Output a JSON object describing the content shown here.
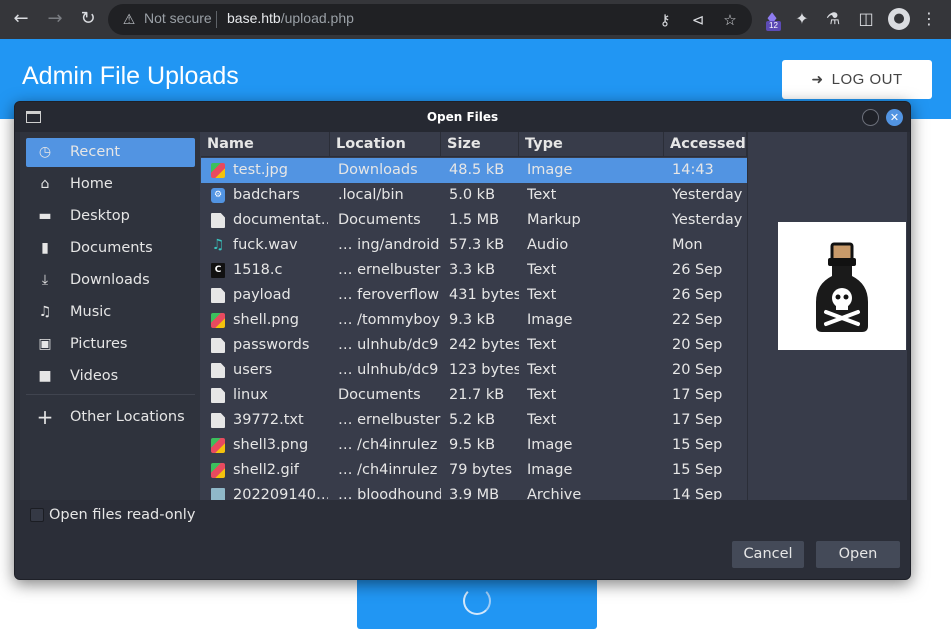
{
  "browser": {
    "security_label": "Not secure",
    "url_host": "base.htb",
    "url_path": "/upload.php",
    "extension_badge": "12"
  },
  "page": {
    "title": "Admin File Uploads",
    "logout_label": "LOG OUT"
  },
  "dialog": {
    "title": "Open Files",
    "sidebar": [
      {
        "label": "Recent",
        "icon": "clock-icon",
        "active": true
      },
      {
        "label": "Home",
        "icon": "home-icon"
      },
      {
        "label": "Desktop",
        "icon": "desktop-icon"
      },
      {
        "label": "Documents",
        "icon": "document-icon"
      },
      {
        "label": "Downloads",
        "icon": "download-icon"
      },
      {
        "label": "Music",
        "icon": "music-icon"
      },
      {
        "label": "Pictures",
        "icon": "picture-icon"
      },
      {
        "label": "Videos",
        "icon": "video-icon"
      },
      {
        "label": "Other Locations",
        "icon": "plus-icon"
      }
    ],
    "columns": [
      "Name",
      "Location",
      "Size",
      "Type",
      "Accessed"
    ],
    "files": [
      {
        "name": "test.jpg",
        "location": "Downloads",
        "size": "48.5 kB",
        "type": "Image",
        "accessed": "14:43",
        "icon": "image-icon",
        "selected": true
      },
      {
        "name": "badchars",
        "location": ".local/bin",
        "size": "5.0 kB",
        "type": "Text",
        "accessed": "Yesterday",
        "icon": "executable-icon"
      },
      {
        "name": "documentat…",
        "location": "Documents",
        "size": "1.5 MB",
        "type": "Markup",
        "accessed": "Yesterday",
        "icon": "text-file-icon"
      },
      {
        "name": "fuck.wav",
        "location": "… ing/android",
        "size": "57.3 kB",
        "type": "Audio",
        "accessed": "Mon",
        "icon": "audio-icon"
      },
      {
        "name": "1518.c",
        "location": "… ernelbuster",
        "size": "3.3 kB",
        "type": "Text",
        "accessed": "26 Sep",
        "icon": "c-source-icon"
      },
      {
        "name": "payload",
        "location": "… feroverflow",
        "size": "431 bytes",
        "type": "Text",
        "accessed": "26 Sep",
        "icon": "text-file-icon"
      },
      {
        "name": "shell.png",
        "location": "… /tommyboy",
        "size": "9.3 kB",
        "type": "Image",
        "accessed": "22 Sep",
        "icon": "image-icon"
      },
      {
        "name": "passwords",
        "location": "… ulnhub/dc9",
        "size": "242 bytes",
        "type": "Text",
        "accessed": "20 Sep",
        "icon": "text-file-icon"
      },
      {
        "name": "users",
        "location": "… ulnhub/dc9",
        "size": "123 bytes",
        "type": "Text",
        "accessed": "20 Sep",
        "icon": "text-file-icon"
      },
      {
        "name": "linux",
        "location": "Documents",
        "size": "21.7 kB",
        "type": "Text",
        "accessed": "17 Sep",
        "icon": "text-file-icon"
      },
      {
        "name": "39772.txt",
        "location": "… ernelbuster",
        "size": "5.2 kB",
        "type": "Text",
        "accessed": "17 Sep",
        "icon": "text-file-icon"
      },
      {
        "name": "shell3.png",
        "location": "… /ch4inrulez",
        "size": "9.5 kB",
        "type": "Image",
        "accessed": "15 Sep",
        "icon": "image-icon"
      },
      {
        "name": "shell2.gif",
        "location": "… /ch4inrulez",
        "size": "79 bytes",
        "type": "Image",
        "accessed": "15 Sep",
        "icon": "image-icon"
      },
      {
        "name": "202209140…",
        "location": "… bloodhound",
        "size": "3.9 MB",
        "type": "Archive",
        "accessed": "14 Sep",
        "icon": "archive-icon"
      }
    ],
    "readonly_label": "Open files read-only",
    "readonly_checked": false,
    "cancel_label": "Cancel",
    "open_label": "Open"
  },
  "colors": {
    "accent": "#5294e2",
    "page_header": "#2196f3",
    "dialog_bg": "#383c4a",
    "sidebar_bg": "#2f333d"
  }
}
